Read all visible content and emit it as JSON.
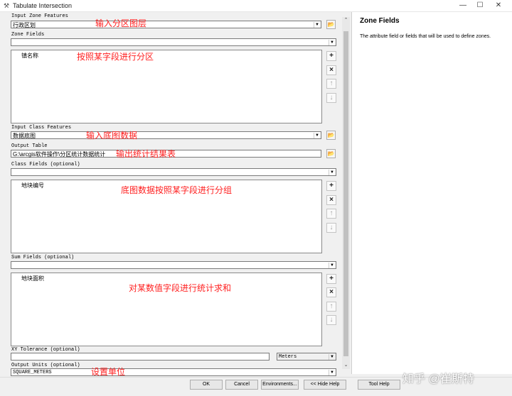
{
  "window": {
    "title": "Tabulate Intersection"
  },
  "fields": {
    "input_zone_label": "Input Zone Features",
    "input_zone_value": "行政区划",
    "zone_fields_label": "Zone Fields",
    "zone_fields_item": "镇名称",
    "input_class_label": "Input Class Features",
    "input_class_value": "数据底图",
    "output_table_label": "Output Table",
    "output_table_value": "G:\\arcgis软件操作\\分区统计数据统计",
    "class_fields_label": "Class Fields (optional)",
    "class_fields_item": "地块编号",
    "sum_fields_label": "Sum Fields (optional)",
    "sum_fields_item": "地块面积",
    "xy_tolerance_label": "XY Tolerance (optional)",
    "xy_units_value": "Meters",
    "output_units_label": "Output Units (optional)",
    "output_units_value": "SQUARE_METERS"
  },
  "annotations": {
    "a1": "输入分区图层",
    "a2": "按照某字段进行分区",
    "a3": "输入底图数据",
    "a4": "输出统计结果表",
    "a5": "底图数据按照某字段进行分组",
    "a6": "对某数值字段进行统计求和",
    "a7": "设置单位"
  },
  "help": {
    "title": "Zone Fields",
    "body": "The attribute field or fields that will be used to define zones."
  },
  "buttons": {
    "ok": "OK",
    "cancel": "Cancel",
    "environments": "Environments...",
    "hide_help": "<< Hide Help",
    "tool_help": "Tool Help"
  },
  "watermark": "知乎 @崔斯特",
  "side_icons": {
    "add": "+",
    "remove": "×",
    "up": "↑",
    "down": "↓",
    "min": "—",
    "max": "☐",
    "close": "✕",
    "folder": "📂",
    "drop": "▼"
  }
}
